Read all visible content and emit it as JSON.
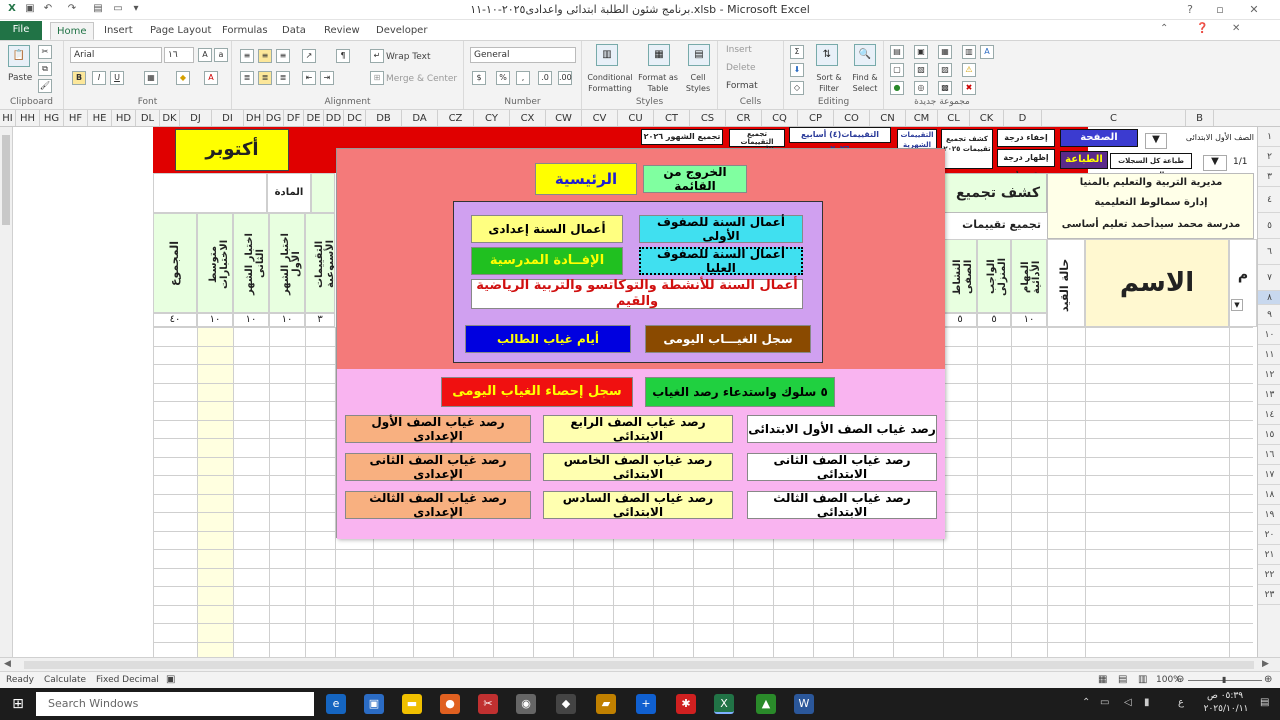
{
  "window": {
    "title": "برنامج شئون الطلبة ابتدائى واعدادى٢٠٢٥-١٠-١١.xlsb  -  Microsoft Excel"
  },
  "tabs": [
    "File",
    "Home",
    "Insert",
    "Page Layout",
    "Formulas",
    "Data",
    "Review",
    "Developer"
  ],
  "ribbon": {
    "clipboard": {
      "paste": "Paste",
      "label": "Clipboard"
    },
    "font": {
      "name": "Arial",
      "size": "١٦",
      "bold": "B",
      "italic": "I",
      "underline": "U",
      "label": "Font"
    },
    "alignment": {
      "wrap": "Wrap Text",
      "merge": "Merge & Center",
      "label": "Alignment"
    },
    "number": {
      "format": "General",
      "label": "Number"
    },
    "styles": {
      "conditional": "Conditional Formatting",
      "table": "Format as Table",
      "cell": "Cell Styles",
      "label": "Styles"
    },
    "cells": {
      "insert": "Insert",
      "delete": "Delete",
      "format": "Format",
      "label": "Cells"
    },
    "editing": {
      "sort": "Sort & Filter",
      "find": "Find & Select",
      "label": "Editing"
    },
    "custom": {
      "label": "مجموعة جديدة"
    }
  },
  "columns": [
    "HI",
    "HH",
    "HG",
    "HF",
    "HE",
    "HD",
    "DL",
    "DK",
    "DJ",
    "DI",
    "DH",
    "DG",
    "DF",
    "DE",
    "DD",
    "DC",
    "DB",
    "DA",
    "CZ",
    "CY",
    "CX",
    "CW",
    "CV",
    "CU",
    "CT",
    "CS",
    "CR",
    "CQ",
    "CP",
    "CO",
    "CN",
    "CM",
    "CL",
    "CK",
    "D",
    "C",
    "B"
  ],
  "rows": [
    "١",
    "٢",
    "٣",
    "٤",
    "٥",
    "٦",
    "٧",
    "٨",
    "٩",
    "١٠",
    "١١",
    "١٢",
    "١٣",
    "١٤",
    "١٥",
    "١٦",
    "١٧",
    "١٨",
    "١٩",
    "٢٠",
    "٢١",
    "٢٢",
    "٢٣"
  ],
  "sheet": {
    "month": "أكتوبر",
    "subject": "المادة",
    "total": "المجموع",
    "avg_tests": "متوسط الاختبارات",
    "test2": "اختبار الشهر الثانى",
    "test1": "اختبار الشهر الأول",
    "truncated_col": "التقييمات الأسبوعية",
    "totals_row": [
      "٤٠",
      "١٠",
      "١٠",
      "١٠",
      "٣"
    ],
    "right_totals": [
      "٥",
      "٥",
      "١٠"
    ],
    "school_lines": [
      "مديرية التربية والتعليم بالمنيا",
      "إدارة سمالوط التعليمية",
      "مدرسة محمد سيدأحمد تعليم أساسى"
    ],
    "grade": "الصف الأول الابتدائى",
    "report_title": "كشف تجميع",
    "collect": "تجميع تقييمات",
    "activity": "النشاط الصفى",
    "homework": "الواجب المنزلى",
    "tasks": "المهام الأدائية",
    "status": "حالة القيد",
    "name": "الاسم",
    "serial": "م",
    "page": "1/1",
    "hdr_buttons": {
      "home_page": "الصفحة الرئيسية",
      "print": "الطباعة",
      "hide_grade": "إخفاء درجة تيرم١",
      "show_grade": "إظهار درجة تيرم١",
      "print_all": "طباعة كل السجلات المحددة",
      "report_2025": "كشف تجميع تقييمات ٢٠٢٥",
      "monthly": "التقييمات الشهرية",
      "weekly4": "التقييمات(٤) أسابيع ٢٠٢٦",
      "collect_weekly": "تجميع التقييمات الأسبوعية",
      "collect_months": "تجميع الشهور ٢٠٢٦"
    }
  },
  "popup": {
    "main": "الرئيسية",
    "exit": "الخروج من القائمة",
    "prep_year": "أعمال السنة إعدادى",
    "primary_lower": "أعمال السنة للصفوف الأولى",
    "benefit": "الإفــادة المدرسية",
    "primary_upper": "أعمال السنة للصفوف العليا",
    "activities": "أعمال السنة للأنشطة والتوكاتسو والتربية الرياضية والقيم",
    "absence_days": "أيام غياب الطالب",
    "daily_absence": "سجل الغيـــاب اليومى",
    "absence_stats": "سجل إحصاء الغياب اليومى",
    "behavior": "٥ سلوك واستدعاء رصد الغياب",
    "grades": [
      [
        "رصد غياب الصف الأول الإعدادى",
        "رصد غياب الصف الرابع الابتدائى",
        "رصد غياب الصف الأول الابتدائى"
      ],
      [
        "رصد غياب الصف الثانى الإعدادى",
        "رصد غياب الصف الخامس الابتدائى",
        "رصد غياب الصف الثانى الابتدائى"
      ],
      [
        "رصد غياب الصف الثالث الإعدادى",
        "رصد غياب الصف السادس الابتدائى",
        "رصد غياب الصف الثالث الابتدائى"
      ]
    ]
  },
  "status": {
    "ready": "Ready",
    "calculate": "Calculate",
    "fixed": "Fixed Decimal",
    "zoom": "100%"
  },
  "taskbar": {
    "search": "Search Windows",
    "time": "٠٥:٣٩ ص",
    "date": "٢٠٢٥/١٠/١١",
    "lang": "ع"
  },
  "colors": {
    "excel_green": "#217346",
    "popup_top": "#f47a7a",
    "popup_bottom": "#f9b4f0"
  }
}
